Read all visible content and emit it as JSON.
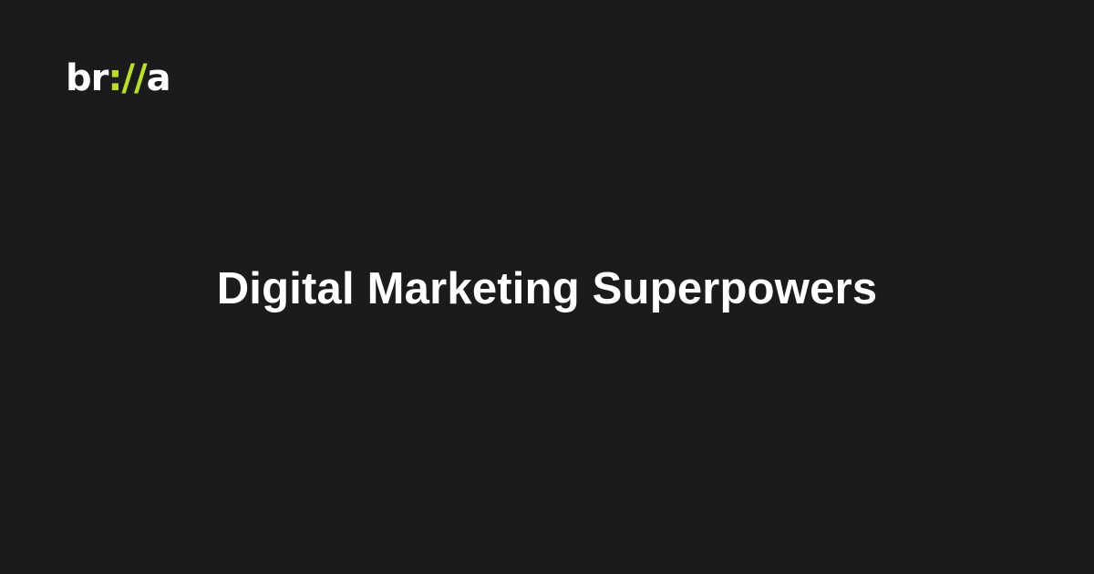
{
  "brand": {
    "logo_prefix": "br",
    "logo_accent": "://",
    "logo_suffix": "a",
    "text_color": "#ffffff",
    "accent_color": "#b7e021"
  },
  "hero": {
    "title": "Digital Marketing Superpowers"
  },
  "colors": {
    "background": "#1b1b1d",
    "title": "#ffffff"
  }
}
